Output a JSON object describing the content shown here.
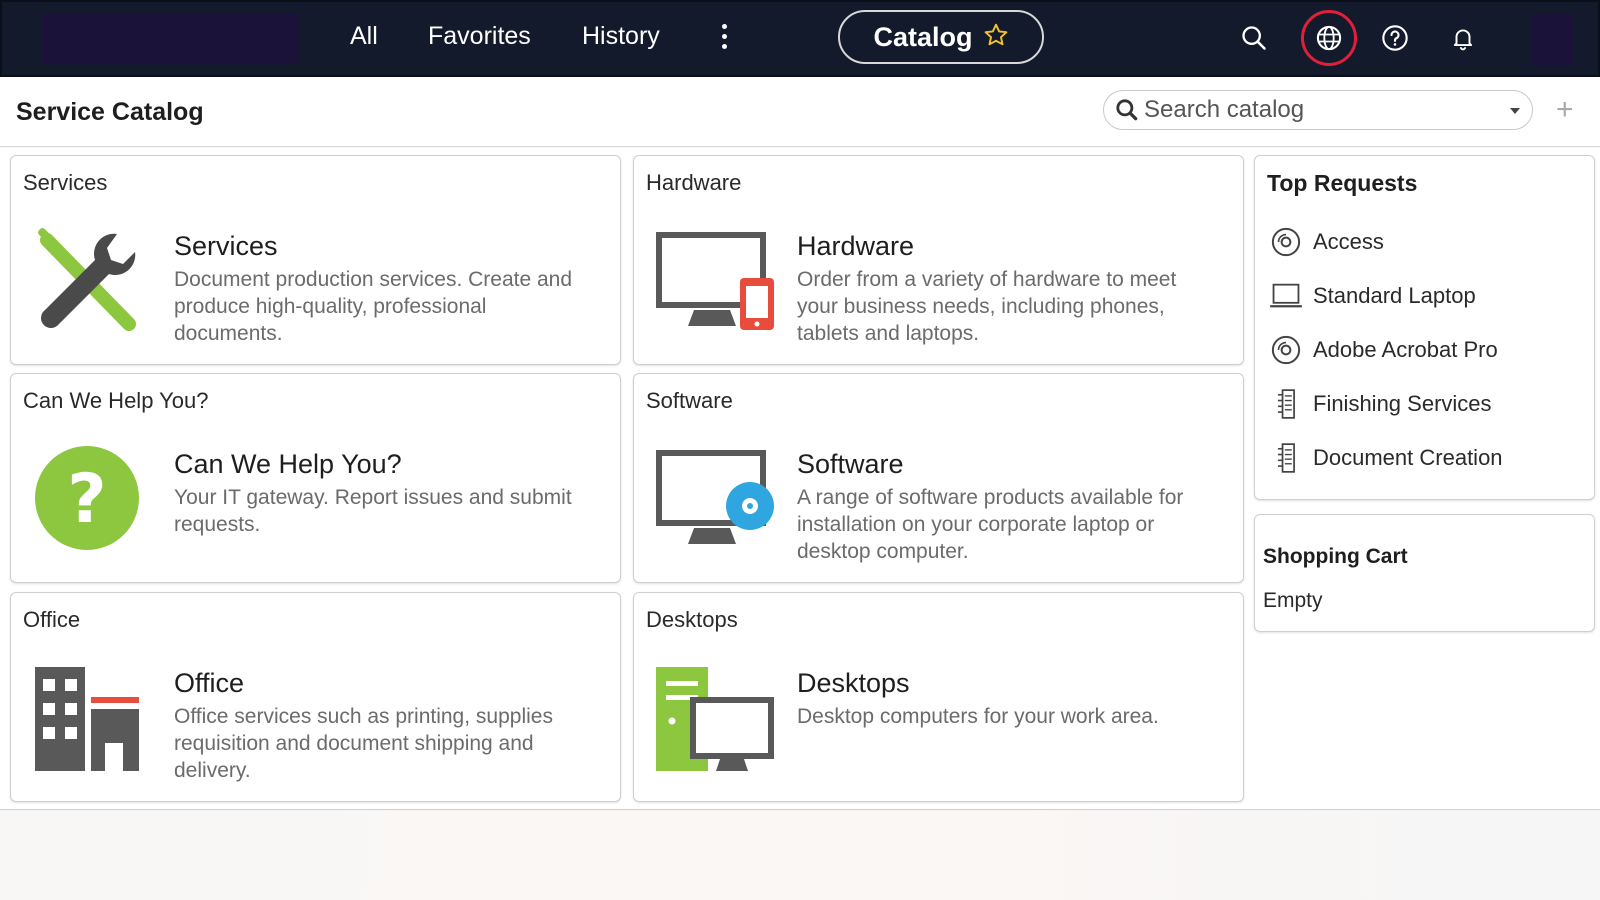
{
  "nav": {
    "all": "All",
    "favorites": "Favorites",
    "history": "History",
    "catalog": "Catalog"
  },
  "icons": {
    "search": "search-icon",
    "globe": "globe-icon",
    "help": "help-icon",
    "notifications": "bell-icon",
    "star": "star-icon",
    "more": "more-vertical-icon"
  },
  "colors": {
    "nav_bg": "#121a2b",
    "highlight_ring": "#e0203b",
    "green": "#8dc63f",
    "desc_gray": "#6b6b6b"
  },
  "header": {
    "title": "Service Catalog",
    "search_placeholder": "Search catalog",
    "add": "+"
  },
  "cards": [
    {
      "category": "Services",
      "title": "Services",
      "desc": "Document production services. Create and produce high-quality, professional documents.",
      "icon": "tools-icon"
    },
    {
      "category": "Hardware",
      "title": "Hardware",
      "desc": "Order from a variety of hardware to meet your business needs, including phones, tablets and laptops.",
      "icon": "monitor-phone-icon"
    },
    {
      "category": "Can We Help You?",
      "title": "Can We Help You?",
      "desc": "Your IT gateway. Report issues and submit requests.",
      "icon": "question-icon"
    },
    {
      "category": "Software",
      "title": "Software",
      "desc": "A range of software products available for installation on your corporate laptop or desktop computer.",
      "icon": "monitor-disc-icon"
    },
    {
      "category": "Office",
      "title": "Office",
      "desc": "Office services such as printing, supplies requisition and document shipping and delivery.",
      "icon": "building-icon"
    },
    {
      "category": "Desktops",
      "title": "Desktops",
      "desc": "Desktop computers for your work area.",
      "icon": "desktop-tower-icon"
    }
  ],
  "top_requests": {
    "title": "Top Requests",
    "items": [
      {
        "label": "Access",
        "icon": "disc-icon"
      },
      {
        "label": "Standard Laptop",
        "icon": "laptop-icon"
      },
      {
        "label": "Adobe Acrobat Pro",
        "icon": "disc-icon"
      },
      {
        "label": "Finishing Services",
        "icon": "document-stack-icon"
      },
      {
        "label": "Document Creation",
        "icon": "document-stack-icon"
      }
    ]
  },
  "cart": {
    "title": "Shopping Cart",
    "status": "Empty"
  }
}
